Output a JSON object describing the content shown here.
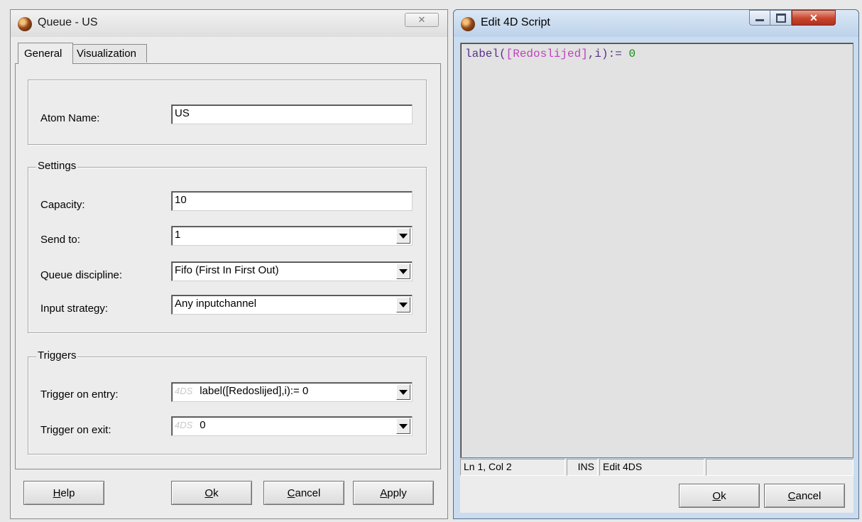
{
  "queue_window": {
    "title": "Queue - US",
    "close_glyph": "✕",
    "tabs": [
      {
        "label": "General",
        "active": true
      },
      {
        "label": "Visualization",
        "active": false
      }
    ],
    "atom_name": {
      "label": "Atom Name:",
      "value": "US"
    },
    "settings": {
      "title": "Settings",
      "capacity": {
        "label": "Capacity:",
        "value": "10"
      },
      "send_to": {
        "label": "Send to:",
        "value": "1"
      },
      "queue_discipline": {
        "label": "Queue discipline:",
        "value": "Fifo (First In First Out)"
      },
      "input_strategy": {
        "label": "Input strategy:",
        "value": "Any inputchannel"
      }
    },
    "triggers": {
      "title": "Triggers",
      "on_entry": {
        "label": "Trigger on entry:",
        "tag": "4DS",
        "value": "label([Redoslijed],i):= 0"
      },
      "on_exit": {
        "label": "Trigger on exit:",
        "tag": "4DS",
        "value": "0"
      }
    },
    "buttons": {
      "help": "Help",
      "ok": "Ok",
      "cancel": "Cancel",
      "apply": "Apply"
    }
  },
  "script_window": {
    "title": "Edit 4D Script",
    "code": {
      "fn": "label(",
      "ref": "[Redoslijed]",
      "rest": ",i):= ",
      "num": "0"
    },
    "status": {
      "position": "Ln 1, Col 2",
      "mode": "INS",
      "editor": "Edit 4DS",
      "extra": ""
    },
    "buttons": {
      "ok": "Ok",
      "cancel": "Cancel"
    }
  },
  "colors": {
    "code_keyword": "#5a2f8a",
    "code_reference": "#c040c0",
    "code_number": "#1a8a1a",
    "titlebar_active": "#c6daf0",
    "titlebar_inactive": "#e3e3e3"
  }
}
